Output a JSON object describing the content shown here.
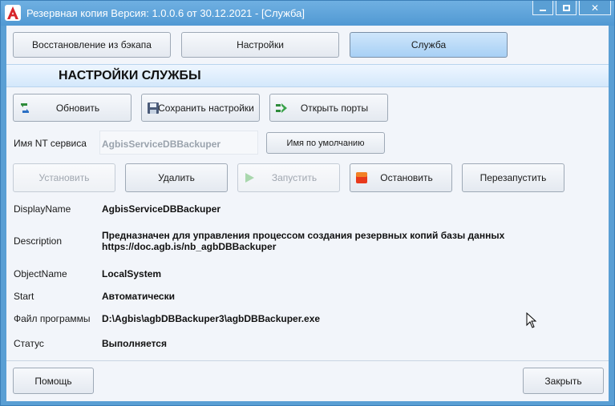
{
  "window": {
    "title": "Резервная копия   Версия: 1.0.0.6 от 30.12.2021 - [Служба]",
    "logo_letter": "A",
    "accent": "#5a9fd4"
  },
  "tabs": [
    {
      "label": "Восстановление из бэкапа",
      "active": false
    },
    {
      "label": "Настройки",
      "active": false
    },
    {
      "label": "Служба",
      "active": true
    }
  ],
  "section": {
    "title": "НАСТРОЙКИ СЛУЖБЫ"
  },
  "toolbar": {
    "refresh_label": "Обновить",
    "save_label": "Сохранить настройки",
    "open_ports_label": "Открыть порты"
  },
  "nt_service": {
    "label": "Имя NT сервиса",
    "value": "AgbisServiceDBBackuper",
    "default_button": "Имя по умолчанию"
  },
  "service_buttons": {
    "install": "Установить",
    "delete": "Удалить",
    "start": "Запустить",
    "stop": "Остановить",
    "restart": "Перезапустить"
  },
  "properties": {
    "display_name_label": "DisplayName",
    "display_name_value": "AgbisServiceDBBackuper",
    "description_label": "Description",
    "description_line1": "Предназначен для управления процессом создания резервных копий базы данных",
    "description_line2": "https://doc.agb.is/nb_agbDBBackuper",
    "object_name_label": "ObjectName",
    "object_name_value": "LocalSystem",
    "start_label": "Start",
    "start_value": "Автоматически",
    "program_label": "Файл программы",
    "program_value": "D:\\Agbis\\agbDBBackuper3\\agbDBBackuper.exe",
    "status_label": "Статус",
    "status_value": "Выполняется"
  },
  "footer": {
    "help_label": "Помощь",
    "close_label": "Закрыть"
  }
}
